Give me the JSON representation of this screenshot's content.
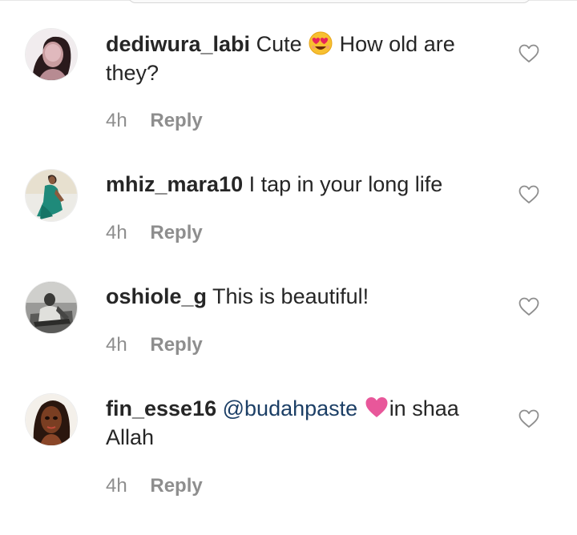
{
  "comments": [
    {
      "username": "dediwura_labi",
      "text_before": "Cute",
      "emoji": "smiling-face-with-heart-eyes",
      "text_after": "How old are they?",
      "time": "4h",
      "reply_label": "Reply"
    },
    {
      "username": "mhiz_mara10",
      "text": "I tap in your long life",
      "time": "4h",
      "reply_label": "Reply"
    },
    {
      "username": "oshiole_g",
      "text": "This is beautiful!",
      "time": "4h",
      "reply_label": "Reply"
    },
    {
      "username": "fin_esse16",
      "mention": "@budahpaste",
      "emoji": "pink-heart",
      "text": "in shaa Allah",
      "time": "4h",
      "reply_label": "Reply"
    }
  ],
  "colors": {
    "username": "#262626",
    "meta": "#8e8e8e",
    "mention": "#1c3f66",
    "heart_emoji": "#e8579a"
  },
  "icons": {
    "like": "heart-outline-icon"
  }
}
